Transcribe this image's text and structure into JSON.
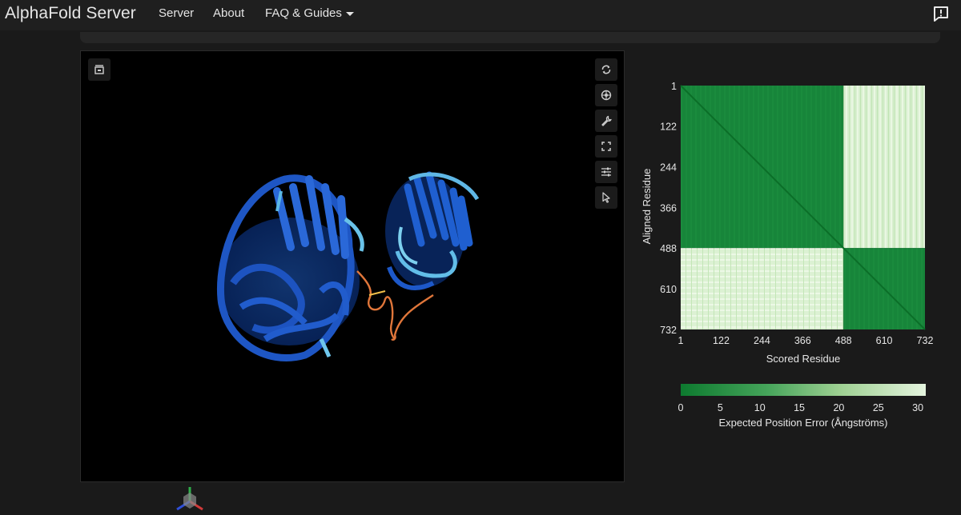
{
  "header": {
    "brand": "AlphaFold Server",
    "nav": {
      "server": "Server",
      "about": "About",
      "faq": "FAQ & Guides"
    }
  },
  "viewer": {
    "left_buttons": [
      "reset-layout-icon"
    ],
    "right_buttons": [
      "rotate-icon",
      "snapshot-icon",
      "wrench-icon",
      "expand-icon",
      "settings-sliders-icon",
      "pointer-icon"
    ]
  },
  "chart_data": {
    "type": "heatmap",
    "xlabel": "Scored Residue",
    "ylabel": "Aligned Residue",
    "x_ticks": [
      "1",
      "122",
      "244",
      "366",
      "488",
      "610",
      "732"
    ],
    "y_ticks": [
      "1",
      "122",
      "244",
      "366",
      "488",
      "610",
      "732"
    ],
    "xlim": [
      1,
      732
    ],
    "ylim": [
      1,
      732
    ],
    "blocks": [
      {
        "x": [
          1,
          488
        ],
        "y": [
          1,
          488
        ],
        "level": "low"
      },
      {
        "x": [
          488,
          732
        ],
        "y": [
          1,
          488
        ],
        "level": "high"
      },
      {
        "x": [
          1,
          488
        ],
        "y": [
          488,
          732
        ],
        "level": "high"
      },
      {
        "x": [
          488,
          732
        ],
        "y": [
          488,
          732
        ],
        "level": "low"
      }
    ],
    "colorbar": {
      "label": "Expected Position Error (Ångströms)",
      "ticks": [
        "0",
        "5",
        "10",
        "15",
        "20",
        "25",
        "30"
      ],
      "range": [
        0,
        31
      ],
      "color_low": "#0d7a2f",
      "color_high": "#e4f4de"
    }
  }
}
